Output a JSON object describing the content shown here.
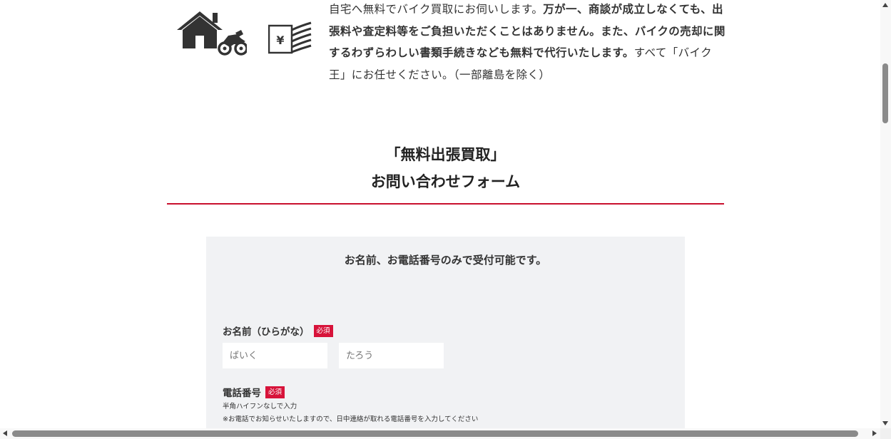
{
  "intro": {
    "icons": [
      "house-bike-icon",
      "yen-bills-icon"
    ],
    "text_part1": "自宅へ無料でバイク買取にお伺いします。",
    "text_bold": "万が一、商談が成立しなくても、出張料や査定料等をご負担いただくことはありません。また、バイクの売却に関するわずらわしい書類手続きなども無料で代行いたします。",
    "text_part2": "すべて「バイク王」にお任せください。（一部離島を除く）"
  },
  "heading": {
    "line1": "「無料出張買取」",
    "line2": "お問い合わせフォーム",
    "rule_color": "#c8102e"
  },
  "form": {
    "lead": "お名前、お電話番号のみで受付可能です。",
    "required_badge": "必須",
    "name": {
      "label": "お名前（ひらがな）",
      "last_placeholder": "ばいく",
      "first_placeholder": "たろう"
    },
    "phone": {
      "label": "電話番号",
      "note1": "半角ハイフンなしで入力",
      "note2": "※お電話でお知らせいたしますので、日中連絡が取れる電話番号を入力してください"
    },
    "badge_color": "#d7133a",
    "panel_color": "#f1f2f4"
  }
}
